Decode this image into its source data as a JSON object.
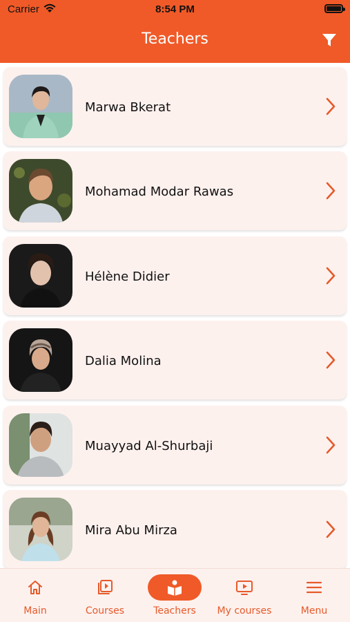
{
  "status_bar": {
    "carrier": "Carrier",
    "time": "8:54 PM"
  },
  "header": {
    "title": "Teachers",
    "filter_icon": "filter-icon"
  },
  "teachers": [
    {
      "name": "Marwa Bkerat"
    },
    {
      "name": "Mohamad Modar Rawas"
    },
    {
      "name": "Hélène Didier"
    },
    {
      "name": "Dalia Molina"
    },
    {
      "name": "Muayyad Al-Shurbaji"
    },
    {
      "name": "Mira Abu Mirza"
    }
  ],
  "tabs": [
    {
      "label": "Main",
      "icon": "home-icon",
      "active": false
    },
    {
      "label": "Courses",
      "icon": "courses-icon",
      "active": false
    },
    {
      "label": "Teachers",
      "icon": "teacher-icon",
      "active": true
    },
    {
      "label": "My courses",
      "icon": "video-icon",
      "active": false
    },
    {
      "label": "Menu",
      "icon": "menu-icon",
      "active": false
    }
  ],
  "colors": {
    "accent": "#f05a28",
    "card_bg": "#fdf1ee",
    "text": "#111111"
  }
}
